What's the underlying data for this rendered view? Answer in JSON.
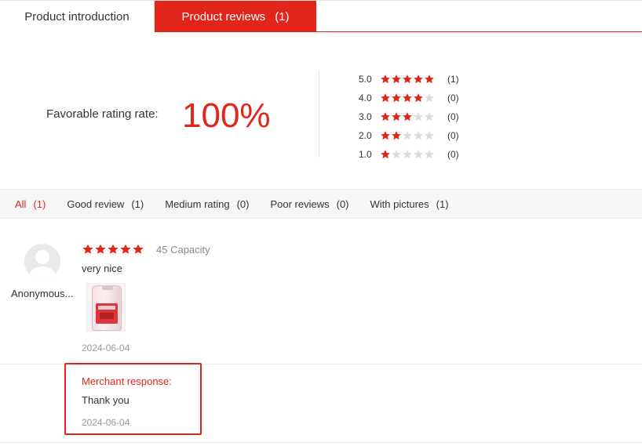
{
  "tabs": {
    "intro_label": "Product introduction",
    "reviews_label": "Product reviews",
    "reviews_count": "(1)"
  },
  "summary": {
    "rate_label": "Favorable rating rate:",
    "rate_value": "100%",
    "distribution": [
      {
        "score": "5.0",
        "stars": 5,
        "count": "(1)"
      },
      {
        "score": "4.0",
        "stars": 4,
        "count": "(0)"
      },
      {
        "score": "3.0",
        "stars": 3,
        "count": "(0)"
      },
      {
        "score": "2.0",
        "stars": 2,
        "count": "(0)"
      },
      {
        "score": "1.0",
        "stars": 1,
        "count": "(0)"
      }
    ]
  },
  "filters": [
    {
      "label": "All",
      "count": "(1)"
    },
    {
      "label": "Good review",
      "count": "(1)"
    },
    {
      "label": "Medium rating",
      "count": "(0)"
    },
    {
      "label": "Poor reviews",
      "count": "(0)"
    },
    {
      "label": "With pictures",
      "count": "(1)"
    }
  ],
  "review": {
    "username": "Anonymous...",
    "stars": 5,
    "variant": "45 Capacity",
    "text": "very nice",
    "date": "2024-06-04",
    "response": {
      "title": "Merchant response:",
      "text": "Thank you",
      "date": "2024-06-04"
    }
  },
  "colors": {
    "accent": "#e1251b",
    "star_empty": "#dcdcdc"
  },
  "icons": {
    "star": "star-icon",
    "avatar": "user-avatar-icon"
  }
}
